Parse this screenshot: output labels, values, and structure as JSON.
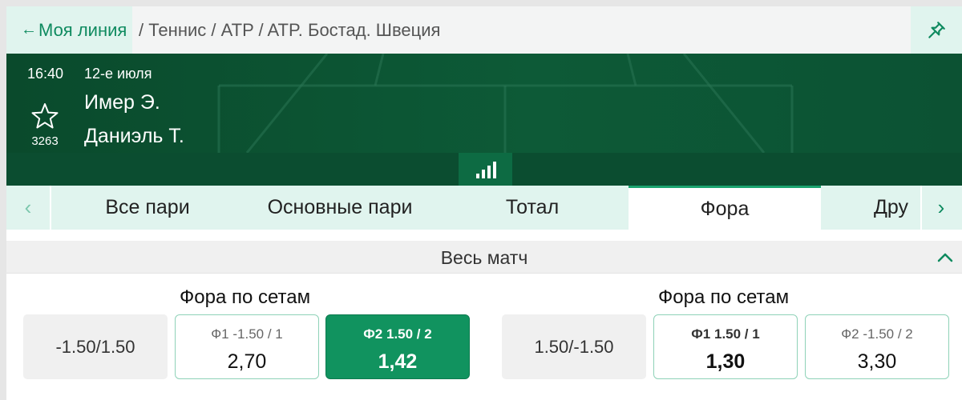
{
  "breadcrumb": {
    "back_label": "Моя линия",
    "path": "/ Теннис / ATP / ATP. Бостад. Швеция"
  },
  "event": {
    "time": "16:40",
    "date": "12-е июля",
    "team1": "Имер Э.",
    "team2": "Даниэль Т.",
    "favorites_count": "3263"
  },
  "tabs": [
    {
      "label": "Все пари",
      "active": false
    },
    {
      "label": "Основные пари",
      "active": false
    },
    {
      "label": "Тотал",
      "active": false
    },
    {
      "label": "Фора",
      "active": true
    },
    {
      "label": "Дру",
      "active": false
    }
  ],
  "section": {
    "title": "Весь матч"
  },
  "markets": [
    {
      "title": "Фора по сетам",
      "line": "-1.50/1.50",
      "odds": [
        {
          "label": "Ф1 -1.50 / 1",
          "value": "2,70",
          "state": "normal"
        },
        {
          "label": "Ф2 1.50 / 2",
          "value": "1,42",
          "state": "selected"
        }
      ]
    },
    {
      "title": "Фора по сетам",
      "line": "1.50/-1.50",
      "odds": [
        {
          "label": "Ф1 1.50 / 1",
          "value": "1,30",
          "state": "bold"
        },
        {
          "label": "Ф2 -1.50 / 2",
          "value": "3,30",
          "state": "normal"
        }
      ]
    }
  ],
  "colors": {
    "accent": "#11935f",
    "header_bg": "#0d5a37",
    "light_accent_bg": "#e0f4ee"
  },
  "icons": {
    "back": "arrow-left-icon",
    "pin": "pin-icon",
    "favorite": "star-icon",
    "stats": "bar-chart-icon",
    "tab_prev": "chevron-left-icon",
    "tab_next": "chevron-right-icon",
    "collapse": "chevron-up-icon"
  }
}
